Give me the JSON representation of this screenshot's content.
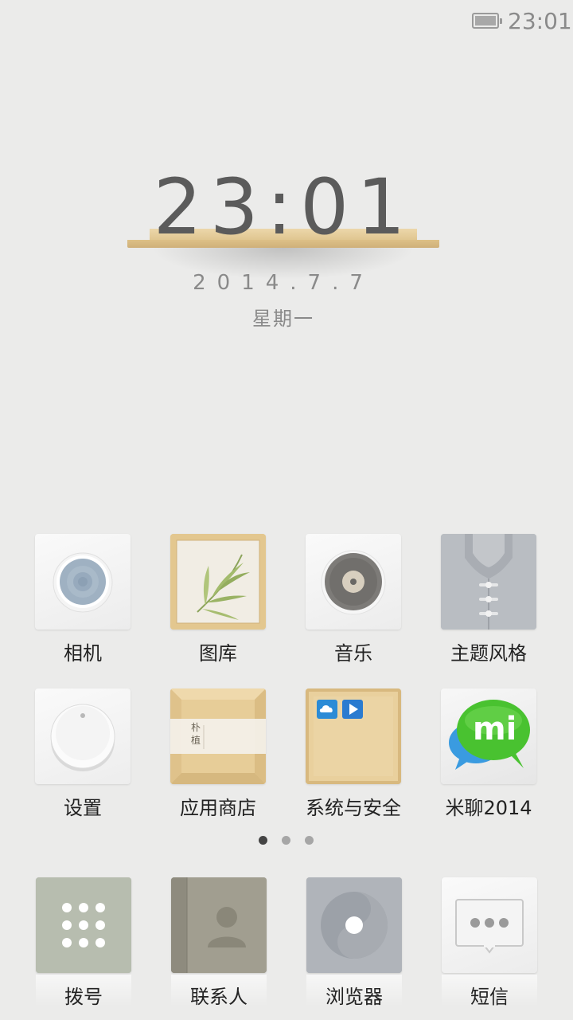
{
  "status_bar": {
    "time": "23:01",
    "battery_icon": "battery-icon"
  },
  "clock": {
    "time": "23:01",
    "date": "2014.7.7",
    "weekday": "星期一"
  },
  "apps": [
    {
      "label": "相机",
      "icon": "camera-icon"
    },
    {
      "label": "图库",
      "icon": "gallery-icon"
    },
    {
      "label": "音乐",
      "icon": "music-icon"
    },
    {
      "label": "主题风格",
      "icon": "theme-icon"
    },
    {
      "label": "设置",
      "icon": "settings-icon"
    },
    {
      "label": "应用商店",
      "icon": "app-store-icon"
    },
    {
      "label": "系统与安全",
      "icon": "security-folder-icon"
    },
    {
      "label": "米聊2014",
      "icon": "miliao-icon"
    }
  ],
  "page_indicator": {
    "count": 3,
    "active": 0
  },
  "dock": [
    {
      "label": "拨号",
      "icon": "dialer-icon"
    },
    {
      "label": "联系人",
      "icon": "contacts-icon"
    },
    {
      "label": "浏览器",
      "icon": "browser-icon"
    },
    {
      "label": "短信",
      "icon": "messages-icon"
    }
  ],
  "gallery_icon_text": [
    "朴",
    "植"
  ],
  "miliao_icon_text": "mi",
  "colors": {
    "background": "#ebebea",
    "wood": "#e0c690",
    "miliao_green": "#4cc234"
  }
}
